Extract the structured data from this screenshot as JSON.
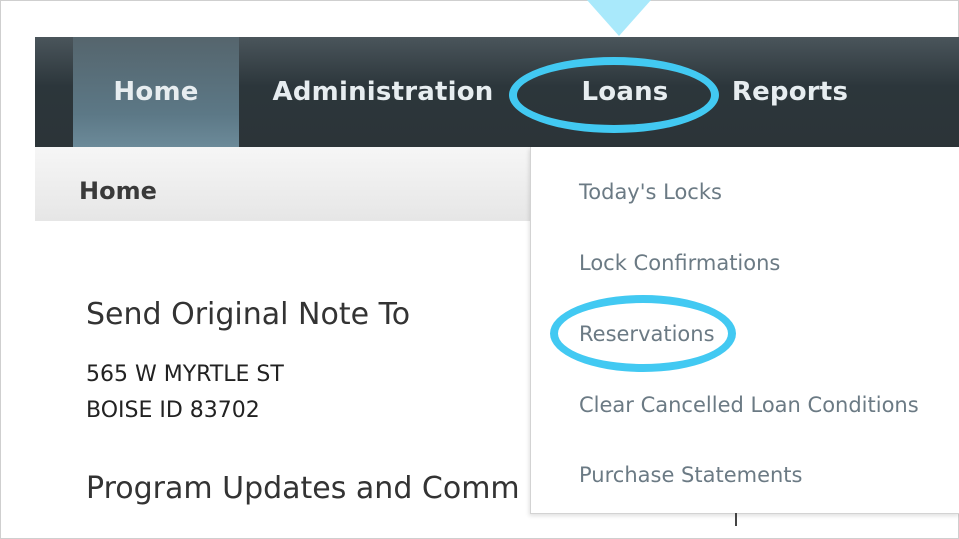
{
  "nav": {
    "items": [
      {
        "label": "Home",
        "active": true
      },
      {
        "label": "Administration",
        "active": false
      },
      {
        "label": "Loans",
        "active": false,
        "highlighted": true
      },
      {
        "label": "Reports",
        "active": false
      }
    ]
  },
  "breadcrumb": {
    "current": "Home"
  },
  "content": {
    "send_heading": "Send Original Note To",
    "address_line1": "565 W MYRTLE ST",
    "address_line2": "BOISE ID 83702",
    "updates_heading": "Program Updates and Comm"
  },
  "loans_menu": {
    "items": [
      {
        "label": "Today's Locks"
      },
      {
        "label": "Lock Confirmations"
      },
      {
        "label": "Reservations",
        "highlighted": true
      },
      {
        "label": "Clear Cancelled Loan Conditions"
      },
      {
        "label": "Purchase Statements"
      }
    ]
  },
  "colors": {
    "nav_bg": "#2c3438",
    "nav_active": "#5c7886",
    "highlight_ring": "#42c9f2",
    "pointer": "#a9e9fb",
    "menu_text": "#6b7a84"
  }
}
